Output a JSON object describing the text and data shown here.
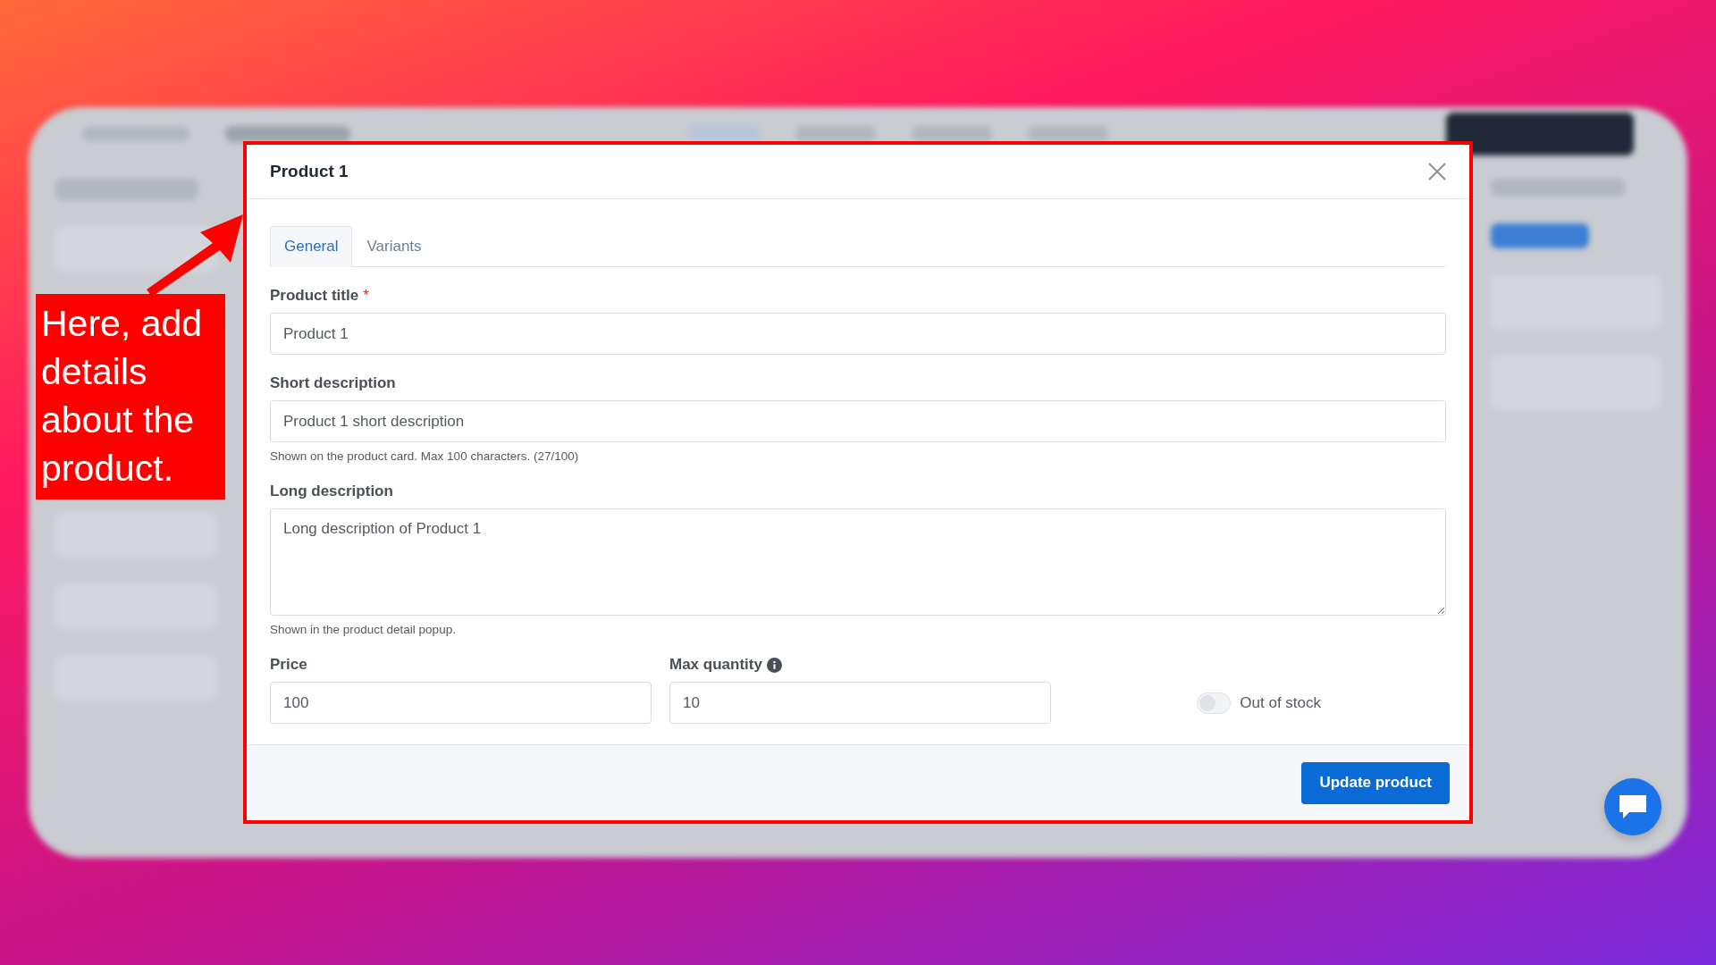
{
  "dialog": {
    "title": "Product 1",
    "tabs": [
      {
        "label": "General",
        "selected": true
      },
      {
        "label": "Variants",
        "selected": false
      }
    ],
    "fields": [
      {
        "kind": "input",
        "label": "Product title",
        "required_mark": "*",
        "value": "Product 1"
      },
      {
        "kind": "input",
        "label": "Short description",
        "value": "Product 1 short description",
        "hint": "Shown on the product card. Max 100 characters. (27/100)"
      },
      {
        "kind": "textarea",
        "label": "Long description",
        "value": "Long description of Product 1",
        "hint": "Shown in the product detail popup."
      }
    ],
    "row_fields": [
      {
        "label": "Price",
        "value": "100",
        "info": false
      },
      {
        "label": "Max quantity",
        "value": "10",
        "info": true
      }
    ],
    "out_of_stock": {
      "label": "Out of stock",
      "on": false
    },
    "submit": "Update product"
  },
  "callout": {
    "text": "Here, add details about the product."
  }
}
